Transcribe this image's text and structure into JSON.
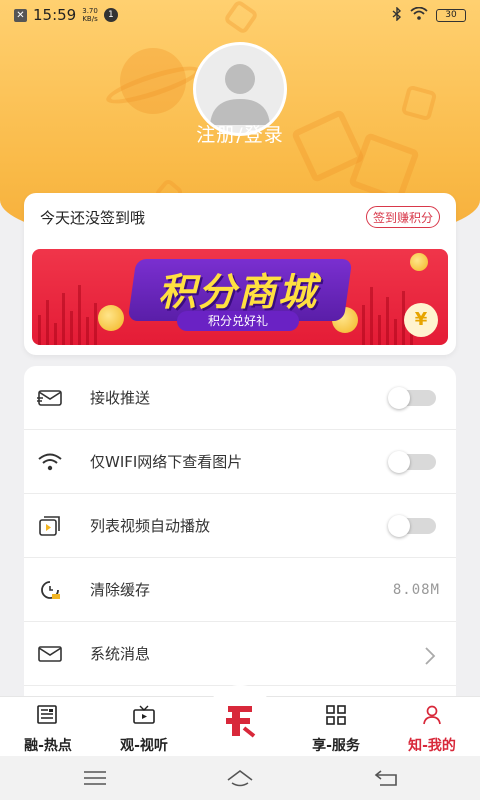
{
  "status_bar": {
    "time": "15:59",
    "speed_value": "3.70",
    "speed_unit": "KB/s",
    "notification_count": "1",
    "battery": "30"
  },
  "profile": {
    "login_label": "注册/登录"
  },
  "signin": {
    "title": "今天还没签到哦",
    "button_label": "签到赚积分",
    "banner_title": "积分商城",
    "banner_subtitle": "积分兑好礼",
    "coin_symbol": "¥"
  },
  "settings": {
    "items": [
      {
        "label": "接收推送",
        "icon": "envelope-icon",
        "control": "toggle",
        "on": false
      },
      {
        "label": "仅WIFI网络下查看图片",
        "icon": "wifi-icon",
        "control": "toggle",
        "on": false
      },
      {
        "label": "列表视频自动播放",
        "icon": "video-play-icon",
        "control": "toggle",
        "on": false
      },
      {
        "label": "清除缓存",
        "icon": "clock-clear-icon",
        "control": "value",
        "value": "8.08M"
      },
      {
        "label": "系统消息",
        "icon": "mail-icon",
        "control": "chevron"
      }
    ]
  },
  "bottom_nav": {
    "items": [
      {
        "label": "融-热点",
        "icon": "newspaper-icon"
      },
      {
        "label": "观-视听",
        "icon": "tv-icon"
      },
      {
        "label": "享-服务",
        "icon": "grid-icon"
      },
      {
        "label": "知-我的",
        "icon": "person-icon",
        "active": true
      }
    ],
    "accent_color": "#d8283a"
  },
  "colors": {
    "header": "#f9b946",
    "accent": "#d8384a",
    "banner": "#e41c36"
  }
}
